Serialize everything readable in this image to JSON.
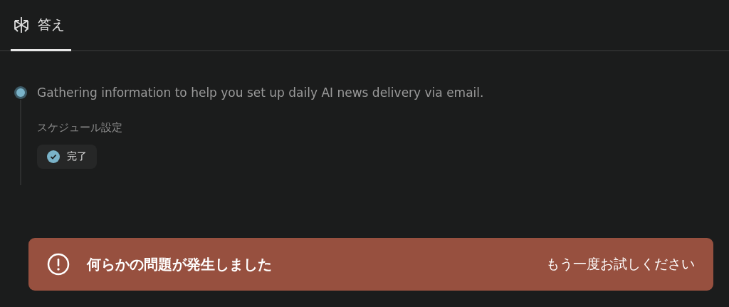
{
  "tabs": [
    {
      "label": "答え",
      "selected": true
    }
  ],
  "steps": [
    {
      "text": "Gathering information to help you set up daily AI news delivery via email.",
      "active": true,
      "substeps": [
        {
          "title": "スケジュール設定",
          "status": "完了",
          "done": true
        }
      ]
    }
  ],
  "error_banner": {
    "message": "何らかの問題が発生しました",
    "action": "もう一度お試しください"
  }
}
